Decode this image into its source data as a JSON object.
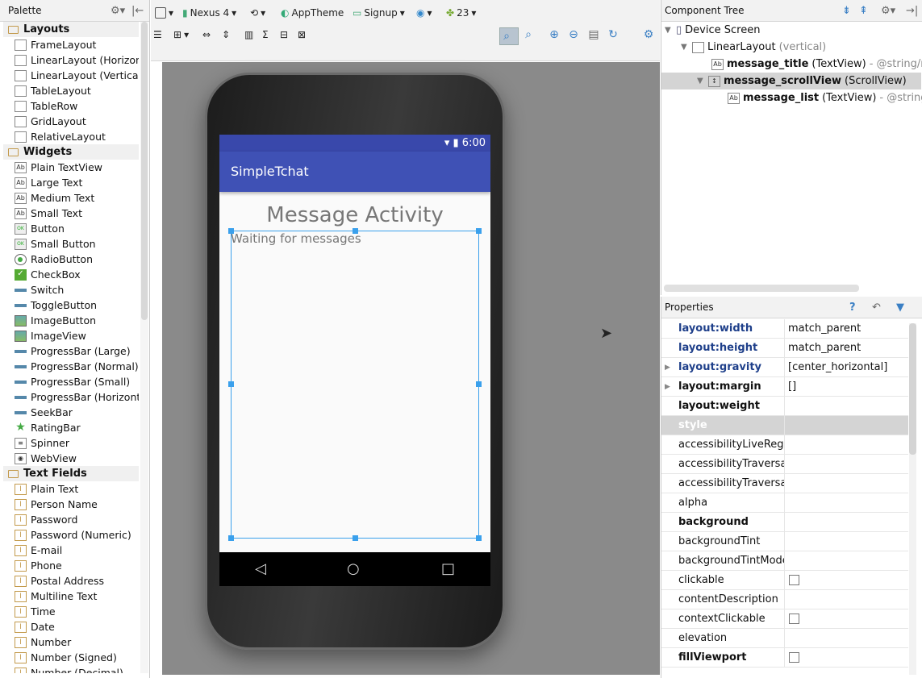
{
  "palette": {
    "title": "Palette",
    "categories": [
      {
        "name": "Layouts",
        "items": [
          {
            "label": "FrameLayout",
            "icon": "frame-layout-icon"
          },
          {
            "label": "LinearLayout (Horizontal)",
            "icon": "linear-layout-horizontal-icon"
          },
          {
            "label": "LinearLayout (Vertical)",
            "icon": "linear-layout-vertical-icon"
          },
          {
            "label": "TableLayout",
            "icon": "table-layout-icon"
          },
          {
            "label": "TableRow",
            "icon": "table-row-icon"
          },
          {
            "label": "GridLayout",
            "icon": "grid-layout-icon"
          },
          {
            "label": "RelativeLayout",
            "icon": "relative-layout-icon"
          }
        ]
      },
      {
        "name": "Widgets",
        "items": [
          {
            "label": "Plain TextView",
            "icon": "textview-icon"
          },
          {
            "label": "Large Text",
            "icon": "textview-icon"
          },
          {
            "label": "Medium Text",
            "icon": "textview-icon"
          },
          {
            "label": "Small Text",
            "icon": "textview-icon"
          },
          {
            "label": "Button",
            "icon": "button-icon"
          },
          {
            "label": "Small Button",
            "icon": "button-icon"
          },
          {
            "label": "RadioButton",
            "icon": "radio-button-icon"
          },
          {
            "label": "CheckBox",
            "icon": "checkbox-icon"
          },
          {
            "label": "Switch",
            "icon": "switch-icon"
          },
          {
            "label": "ToggleButton",
            "icon": "toggle-button-icon"
          },
          {
            "label": "ImageButton",
            "icon": "image-button-icon"
          },
          {
            "label": "ImageView",
            "icon": "image-view-icon"
          },
          {
            "label": "ProgressBar (Large)",
            "icon": "progress-bar-icon"
          },
          {
            "label": "ProgressBar (Normal)",
            "icon": "progress-bar-icon"
          },
          {
            "label": "ProgressBar (Small)",
            "icon": "progress-bar-icon"
          },
          {
            "label": "ProgressBar (Horizontal)",
            "icon": "progress-bar-icon"
          },
          {
            "label": "SeekBar",
            "icon": "seekbar-icon"
          },
          {
            "label": "RatingBar",
            "icon": "rating-bar-icon"
          },
          {
            "label": "Spinner",
            "icon": "spinner-icon"
          },
          {
            "label": "WebView",
            "icon": "webview-icon"
          }
        ]
      },
      {
        "name": "Text Fields",
        "items": [
          {
            "label": "Plain Text",
            "icon": "text-field-icon"
          },
          {
            "label": "Person Name",
            "icon": "text-field-icon"
          },
          {
            "label": "Password",
            "icon": "text-field-icon"
          },
          {
            "label": "Password (Numeric)",
            "icon": "text-field-icon"
          },
          {
            "label": "E-mail",
            "icon": "text-field-icon"
          },
          {
            "label": "Phone",
            "icon": "text-field-icon"
          },
          {
            "label": "Postal Address",
            "icon": "text-field-icon"
          },
          {
            "label": "Multiline Text",
            "icon": "text-field-icon"
          },
          {
            "label": "Time",
            "icon": "text-field-icon"
          },
          {
            "label": "Date",
            "icon": "text-field-icon"
          },
          {
            "label": "Number",
            "icon": "text-field-icon"
          },
          {
            "label": "Number (Signed)",
            "icon": "text-field-icon"
          },
          {
            "label": "Number (Decimal)",
            "icon": "text-field-icon"
          }
        ]
      }
    ]
  },
  "toolbar": {
    "device": "Nexus 4",
    "theme": "AppTheme",
    "activity": "Signup",
    "api_level": "23"
  },
  "device_preview": {
    "status_time": "6:00",
    "app_name": "SimpleTchat",
    "title_text": "Message Activity",
    "body_text": "Waiting for messages"
  },
  "component_tree": {
    "title": "Component Tree",
    "nodes": [
      {
        "name": "Device Screen",
        "type": ""
      },
      {
        "name": "LinearLayout",
        "type": "(vertical)"
      },
      {
        "name": "message_title",
        "type": "(TextView)",
        "extra": "- @string/m"
      },
      {
        "name": "message_scrollView",
        "type": "(ScrollView)"
      },
      {
        "name": "message_list",
        "type": "(TextView)",
        "extra": "- @string"
      }
    ]
  },
  "properties": {
    "title": "Properties",
    "rows": [
      {
        "name": "layout:width",
        "value": "match_parent",
        "style": "blue"
      },
      {
        "name": "layout:height",
        "value": "match_parent",
        "style": "blue"
      },
      {
        "name": "layout:gravity",
        "value": "[center_horizontal]",
        "style": "blue",
        "expandable": true
      },
      {
        "name": "layout:margin",
        "value": "[]",
        "style": "bold",
        "expandable": true
      },
      {
        "name": "layout:weight",
        "value": "",
        "style": "bold"
      },
      {
        "name": "style",
        "value": "",
        "style": "section"
      },
      {
        "name": "accessibilityLiveRegion",
        "value": "",
        "style": "normal"
      },
      {
        "name": "accessibilityTraversalAfter",
        "value": "",
        "style": "normal"
      },
      {
        "name": "accessibilityTraversalBefore",
        "value": "",
        "style": "normal"
      },
      {
        "name": "alpha",
        "value": "",
        "style": "normal"
      },
      {
        "name": "background",
        "value": "",
        "style": "bold"
      },
      {
        "name": "backgroundTint",
        "value": "",
        "style": "normal"
      },
      {
        "name": "backgroundTintMode",
        "value": "",
        "style": "normal"
      },
      {
        "name": "clickable",
        "value": "",
        "style": "normal",
        "checkbox": true
      },
      {
        "name": "contentDescription",
        "value": "",
        "style": "normal"
      },
      {
        "name": "contextClickable",
        "value": "",
        "style": "normal",
        "checkbox": true
      },
      {
        "name": "elevation",
        "value": "",
        "style": "normal"
      },
      {
        "name": "fillViewport",
        "value": "",
        "style": "bold",
        "checkbox": true
      }
    ]
  },
  "colors": {
    "accent": "#3f51b5",
    "selection": "#3aa0ec",
    "property_blue": "#1e3f8a"
  }
}
